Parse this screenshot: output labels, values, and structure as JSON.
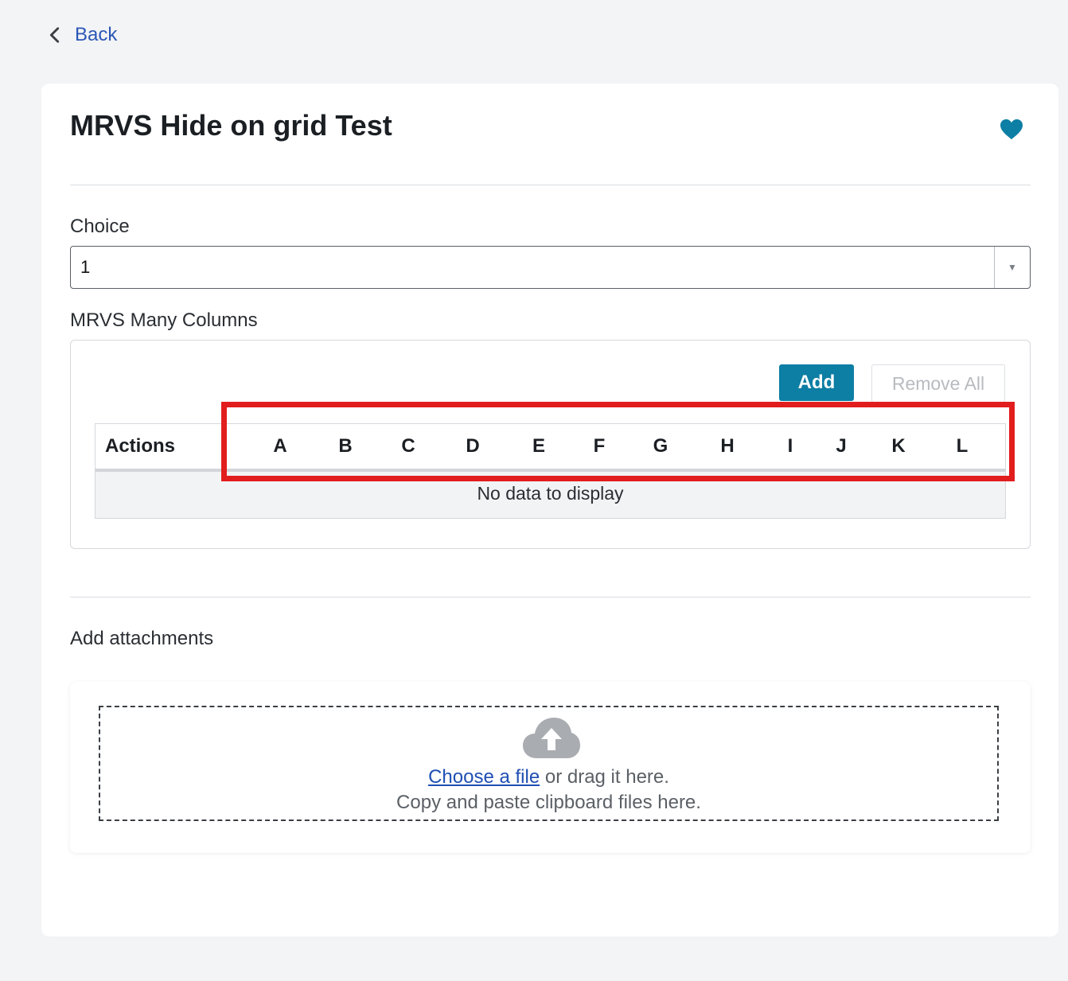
{
  "nav": {
    "back_label": "Back"
  },
  "form": {
    "title": "MRVS Hide on grid Test",
    "choice": {
      "label": "Choice",
      "value": "1"
    },
    "mrvs": {
      "label": "MRVS Many Columns",
      "add_label": "Add",
      "remove_all_label": "Remove All",
      "columns": [
        "Actions",
        "A",
        "B",
        "C",
        "D",
        "E",
        "F",
        "G",
        "H",
        "I",
        "J",
        "K",
        "L"
      ],
      "empty_message": "No data to display"
    },
    "attachments": {
      "label": "Add attachments",
      "choose_link": "Choose a file",
      "drag_text": " or drag it here.",
      "paste_text": "Copy and paste clipboard files here."
    }
  },
  "colors": {
    "accent": "#0d7ea4",
    "link": "#2b57b5",
    "highlight": "#e21d1d",
    "favorite": "#0d7ea4"
  }
}
